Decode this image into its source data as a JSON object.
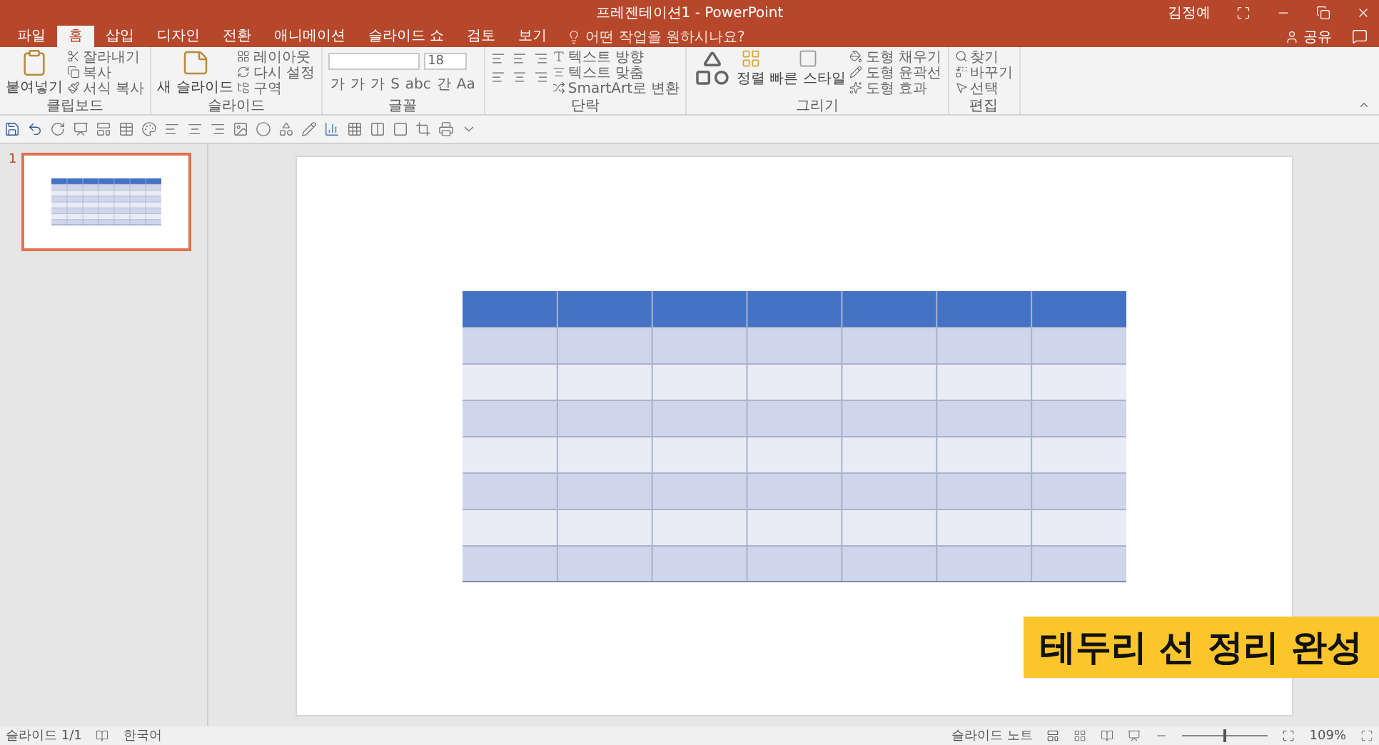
{
  "title_bar": {
    "title": "프레젠테이션1  -  PowerPoint",
    "user": "김정예"
  },
  "tabs": [
    {
      "label": "파일",
      "selected": false
    },
    {
      "label": "홈",
      "selected": true
    },
    {
      "label": "삽입",
      "selected": false
    },
    {
      "label": "디자인",
      "selected": false
    },
    {
      "label": "전환",
      "selected": false
    },
    {
      "label": "애니메이션",
      "selected": false
    },
    {
      "label": "슬라이드 쇼",
      "selected": false
    },
    {
      "label": "검토",
      "selected": false
    },
    {
      "label": "보기",
      "selected": false
    }
  ],
  "tell_me": {
    "placeholder": "어떤 작업을 원하시나요?"
  },
  "share": "공유",
  "ribbon": {
    "groups": [
      {
        "label": "클립보드",
        "big": "붙여넣기",
        "items": [
          "잘라내기",
          "복사",
          "서식 복사"
        ]
      },
      {
        "label": "슬라이드",
        "big": "새 슬라이드",
        "items": [
          "레이아웃",
          "다시 설정",
          "구역"
        ]
      },
      {
        "label": "글꼴",
        "font_size": "18",
        "format_buttons": [
          "가",
          "가",
          "가",
          "S",
          "abc",
          "간",
          "Aa"
        ]
      },
      {
        "label": "단락",
        "items": [
          "텍스트 방향",
          "텍스트 맞춤",
          "SmartArt로 변환"
        ]
      },
      {
        "label": "그리기",
        "big": "정렬",
        "big2": "빠른 스타일",
        "items": [
          "도형 채우기",
          "도형 윤곽선",
          "도형 효과"
        ]
      },
      {
        "label": "편집",
        "items": [
          "찾기",
          "바꾸기",
          "선택"
        ]
      }
    ]
  },
  "slides": [
    {
      "number": "1",
      "selected": true
    }
  ],
  "caption": "테두리 선 정리 완성",
  "status_bar": {
    "slide": "슬라이드 1/1",
    "language": "한국어",
    "notes": "슬라이드 노트",
    "zoom": "109%",
    "zoom_slider": {
      "level": 0.5
    }
  }
}
